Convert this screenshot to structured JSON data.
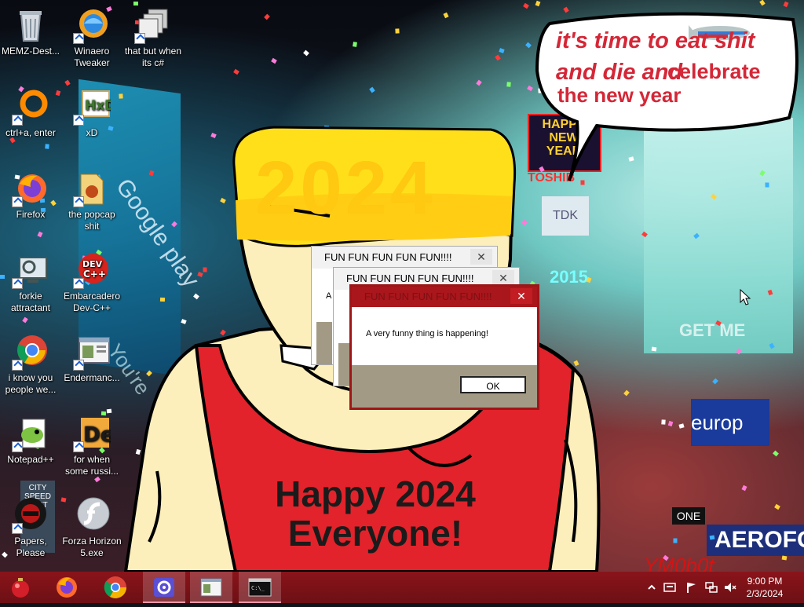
{
  "wallpaper": {
    "year": "2024",
    "greeting_line1": "Happy 2024",
    "greeting_line2": "Everyone!",
    "bubble_line1": "it's time to eat shit",
    "bubble_line2": "and die and",
    "bubble_line2b": "celebrate",
    "bubble_line3": "the new year",
    "sign_newyear": "HAPPY NEW YEAR",
    "sign_tosh": "TOSHIB",
    "sign_tdk": "TDK",
    "sign_2015": "2015",
    "sign_google": "Google play",
    "sign_europa": "europ",
    "sign_aerofos": "AEROFOS",
    "sign_one": "ONE",
    "sign_get": "GET ME",
    "sign_city": "CITY SPEED LIMIT",
    "sign_youre": "You're",
    "watermark": "YM0b0t"
  },
  "desktop_icons": [
    {
      "label": "MEMZ-Dest...",
      "icon": "recycle-bin-icon"
    },
    {
      "label": "Winaero Tweaker",
      "icon": "winaero-icon"
    },
    {
      "label": "that but when its c#",
      "icon": "stacked-windows-icon"
    },
    {
      "label": "ctrl+a, enter",
      "icon": "orange-ring-icon"
    },
    {
      "label": "xD",
      "icon": "hxd-icon"
    },
    {
      "label": "Firefox",
      "icon": "firefox-icon"
    },
    {
      "label": "the popcap shit",
      "icon": "popcap-icon"
    },
    {
      "label": "forkie attractant",
      "icon": "settings-monitor-icon"
    },
    {
      "label": "Embarcadero Dev-C++",
      "icon": "devcpp-icon"
    },
    {
      "label": "i know you people we...",
      "icon": "chrome-icon"
    },
    {
      "label": "Endermanc...",
      "icon": "window-app-icon"
    },
    {
      "label": "Notepad++",
      "icon": "notepadpp-icon"
    },
    {
      "label": "for when some russi...",
      "icon": "de-icon"
    },
    {
      "label": "Papers, Please",
      "icon": "papers-please-icon"
    },
    {
      "label": "Forza Horizon 5.exe",
      "icon": "flash-icon"
    }
  ],
  "dialogs": {
    "back_title": "FUN FUN FUN FUN FUN!!!!",
    "middle_title": "FUN FUN FUN FUN FUN!!!!",
    "middle_body_snippet": "A",
    "front_title": "FUN FUN FUN FUN FUN!!!!",
    "front_message": "A very funny thing is happening!",
    "ok_label": "OK",
    "close_glyph": "✕"
  },
  "taskbar": {
    "pinned": [
      "ornament-start-icon",
      "firefox-icon",
      "chrome-icon",
      "settings-gear-icon",
      "window-app-icon",
      "terminal-icon"
    ],
    "time": "9:00 PM",
    "date": "2/3/2024",
    "tray": [
      "chevron-up-icon",
      "keyboard-icon",
      "flag-icon",
      "network-icon",
      "volume-muted-icon"
    ]
  }
}
